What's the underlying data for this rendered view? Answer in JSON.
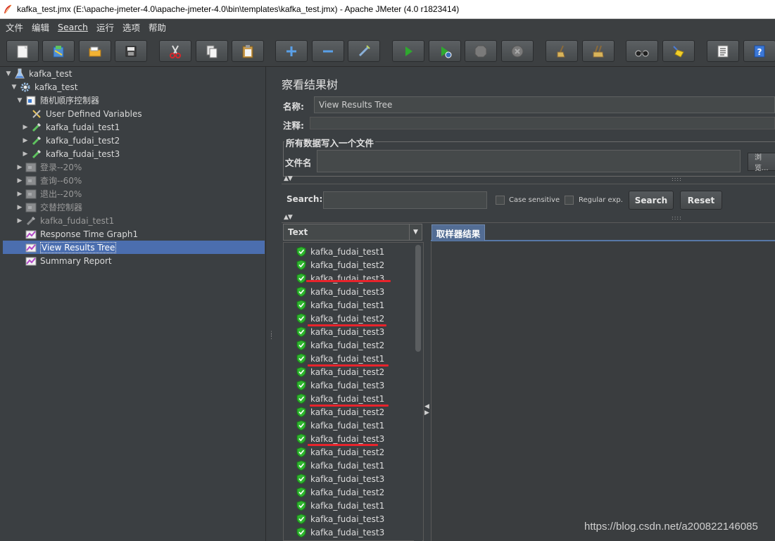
{
  "window": {
    "title": "kafka_test.jmx (E:\\apache-jmeter-4.0\\apache-jmeter-4.0\\bin\\templates\\kafka_test.jmx) - Apache JMeter (4.0 r1823414)"
  },
  "menu": [
    {
      "label": "文件"
    },
    {
      "label": "编辑"
    },
    {
      "label": "Search"
    },
    {
      "label": "运行"
    },
    {
      "label": "选项"
    },
    {
      "label": "帮助"
    }
  ],
  "toolbar": [
    {
      "name": "new-button",
      "icon": "new-document-icon"
    },
    {
      "name": "templates-button",
      "icon": "templates-icon"
    },
    {
      "name": "open-button",
      "icon": "folder-icon"
    },
    {
      "name": "save-button",
      "icon": "save-icon"
    },
    {
      "name": "cut-button",
      "icon": "scissors-icon"
    },
    {
      "name": "copy-button",
      "icon": "copy-icon"
    },
    {
      "name": "paste-button",
      "icon": "paste-icon"
    },
    {
      "name": "expand-button",
      "icon": "plus-icon"
    },
    {
      "name": "collapse-button",
      "icon": "minus-icon"
    },
    {
      "name": "toggle-button",
      "icon": "wand-icon"
    },
    {
      "name": "start-button",
      "icon": "play-icon"
    },
    {
      "name": "start-no-pause-button",
      "icon": "play-no-timers-icon"
    },
    {
      "name": "stop-button",
      "icon": "stop-icon"
    },
    {
      "name": "shutdown-button",
      "icon": "shutdown-icon"
    },
    {
      "name": "clear-button",
      "icon": "broom-icon"
    },
    {
      "name": "clear-all-button",
      "icon": "broom-all-icon"
    },
    {
      "name": "search-button",
      "icon": "binoculars-icon"
    },
    {
      "name": "reset-search-button",
      "icon": "broom-yellow-icon"
    },
    {
      "name": "function-helper-button",
      "icon": "list-icon"
    },
    {
      "name": "help-button",
      "icon": "help-icon"
    }
  ],
  "tree": [
    {
      "label": "kafka_test",
      "icon": "flask-icon",
      "expanded": true,
      "disabled": false
    },
    {
      "label": "kafka_test",
      "icon": "gear-icon",
      "expanded": true,
      "disabled": false
    },
    {
      "label": "随机顺序控制器",
      "icon": "controller-icon",
      "expanded": true,
      "disabled": false
    },
    {
      "label": "User Defined Variables",
      "icon": "tools-icon",
      "expanded": false,
      "disabled": false
    },
    {
      "label": "kafka_fudai_test1",
      "icon": "pipette-icon",
      "expanded": false,
      "disabled": false
    },
    {
      "label": "kafka_fudai_test2",
      "icon": "pipette-icon",
      "expanded": false,
      "disabled": false
    },
    {
      "label": "kafka_fudai_test3",
      "icon": "pipette-icon",
      "expanded": false,
      "disabled": false
    },
    {
      "label": "登录--20%",
      "icon": "disabled-controller-icon",
      "expanded": false,
      "disabled": true
    },
    {
      "label": "查询--60%",
      "icon": "disabled-controller-icon",
      "expanded": false,
      "disabled": true
    },
    {
      "label": "退出--20%",
      "icon": "disabled-controller-icon",
      "expanded": false,
      "disabled": true
    },
    {
      "label": "交替控制器",
      "icon": "disabled-controller-icon",
      "expanded": false,
      "disabled": true
    },
    {
      "label": "kafka_fudai_test1",
      "icon": "disabled-pipette-icon",
      "expanded": false,
      "disabled": true
    },
    {
      "label": "Response Time Graph1",
      "icon": "graph-icon",
      "expanded": false,
      "disabled": false
    },
    {
      "label": "View Results Tree",
      "icon": "graph-icon",
      "expanded": false,
      "disabled": false,
      "selected": true
    },
    {
      "label": "Summary Report",
      "icon": "graph-icon",
      "expanded": false,
      "disabled": false
    }
  ],
  "panel": {
    "title": "察看结果树",
    "name_label": "名称:",
    "name_value": "View Results Tree",
    "comment_label": "注释:",
    "comment_value": "",
    "file_group_title": "所有数据写入一个文件",
    "filename_label": "文件名",
    "filename_value": "",
    "browse_label": "浏览...",
    "search_label": "Search:",
    "search_value": "",
    "case_sensitive_label": "Case sensitive",
    "regex_label": "Regular exp.",
    "search_button": "Search",
    "reset_button": "Reset",
    "renderer_selected": "Text",
    "tab_label": "取样器结果"
  },
  "results": [
    "kafka_fudai_test1",
    "kafka_fudai_test2",
    "kafka_fudai_test3",
    "kafka_fudai_test3",
    "kafka_fudai_test1",
    "kafka_fudai_test2",
    "kafka_fudai_test3",
    "kafka_fudai_test2",
    "kafka_fudai_test1",
    "kafka_fudai_test2",
    "kafka_fudai_test3",
    "kafka_fudai_test1",
    "kafka_fudai_test2",
    "kafka_fudai_test1",
    "kafka_fudai_test3",
    "kafka_fudai_test2",
    "kafka_fudai_test1",
    "kafka_fudai_test3",
    "kafka_fudai_test2",
    "kafka_fudai_test1",
    "kafka_fudai_test3",
    "kafka_fudai_test3"
  ],
  "watermark": "https://blog.csdn.net/a200822146085",
  "colors": {
    "background": "#3b3f42",
    "selection": "#4b6eaf",
    "success_green": "#2fb52f",
    "annotation_red": "#e8232b"
  }
}
